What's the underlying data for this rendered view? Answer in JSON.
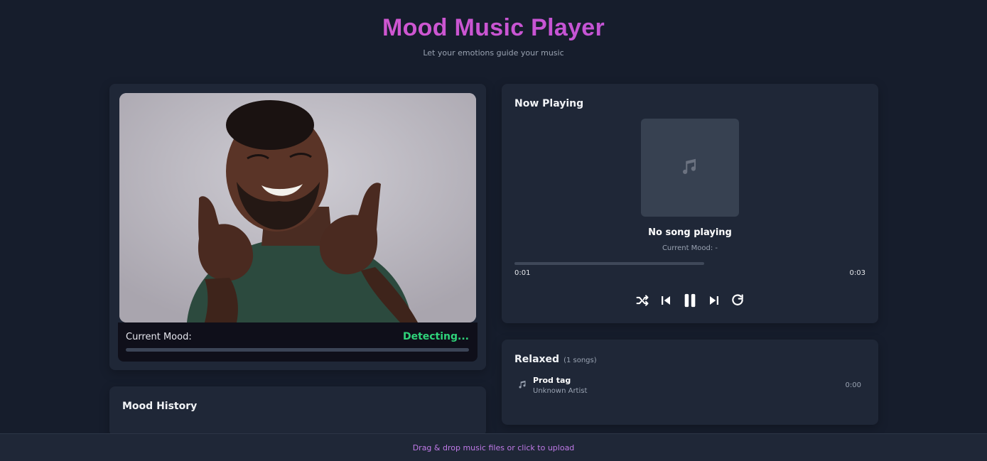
{
  "header": {
    "title": "Mood Music Player",
    "subtitle": "Let your emotions guide your music"
  },
  "camera": {
    "mood_label": "Current Mood:",
    "mood_value": "Detecting...",
    "mood_confidence": 0,
    "mood_color": "#2fd37a"
  },
  "history": {
    "title": "Mood History"
  },
  "player": {
    "title": "Now Playing",
    "song_title": "No song playing",
    "current_mood": "Current Mood: -",
    "elapsed": "0:01",
    "duration": "0:03",
    "progress": 0.54,
    "controls": [
      "shuffle-icon",
      "previous-icon",
      "pause-icon",
      "next-icon",
      "repeat-icon"
    ]
  },
  "playlist": {
    "name": "Relaxed",
    "count": "(1 songs)",
    "tracks": [
      {
        "title": "Prod tag",
        "artist": "Unknown Artist",
        "duration": "0:00"
      }
    ]
  },
  "upload": {
    "label": "Drag & drop music files or click to upload"
  },
  "colors": {
    "background": "#161d2c",
    "card": "#1f2737",
    "accent_pink": "#e25bc9",
    "accent_purple": "#b14fdc",
    "mood_green": "#2fd37a"
  }
}
